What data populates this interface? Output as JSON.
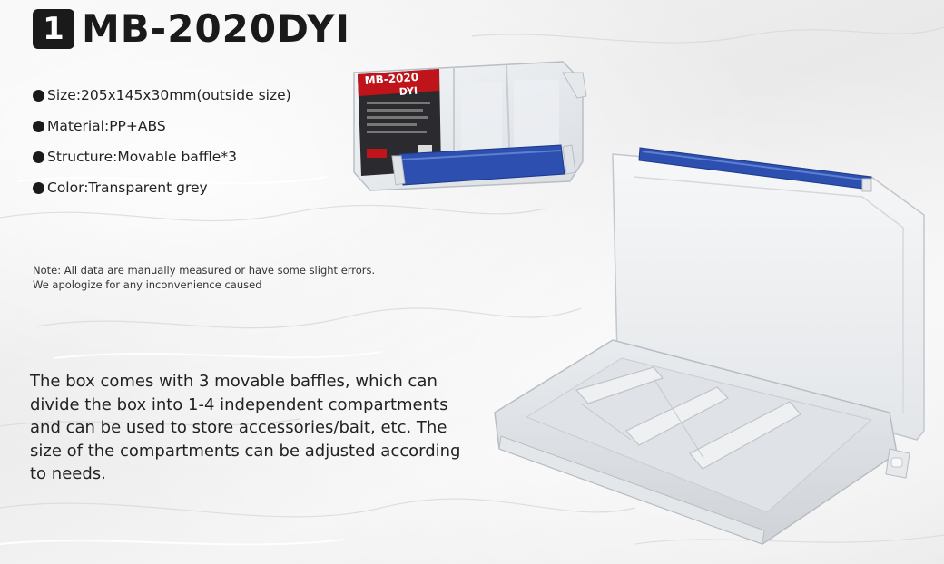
{
  "badge_number": "1",
  "model": "MB-2020DYI",
  "specs": [
    "Size:205x145x30mm(outside size)",
    "Material:PP+ABS",
    "Structure:Movable baffle*3",
    "Color:Transparent grey"
  ],
  "note": "Note: All data are manually measured or have some slight errors. We apologize for any inconvenience caused",
  "description": "The box comes with 3 movable baffles, which can divide the box into 1-4 independent compartments and can be used to store accessories/bait, etc. The size of the compartments can be adjusted according to needs.",
  "product_label": {
    "line1": "MB-2020",
    "line2": "DYI"
  },
  "colors": {
    "latch_blue": "#2c4fb0",
    "label_red": "#c0141b"
  }
}
